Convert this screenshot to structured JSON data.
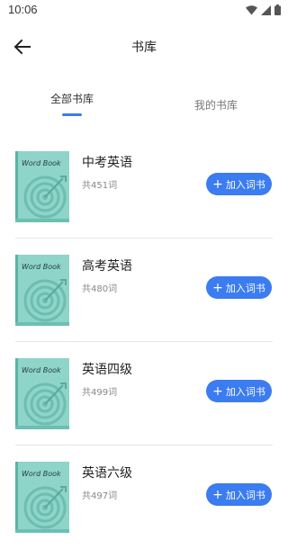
{
  "status_bar": {
    "time": "10:06"
  },
  "header": {
    "title": "书库"
  },
  "tabs": [
    {
      "label": "全部书库"
    },
    {
      "label": "我的书库"
    }
  ],
  "cover_text": "Word Book",
  "colors": {
    "accent": "#3b7cf0",
    "cover": "#8fd4c9"
  },
  "books": [
    {
      "name": "中考英语",
      "count": "共451词",
      "action": "加入词书"
    },
    {
      "name": "高考英语",
      "count": "共480词",
      "action": "加入词书"
    },
    {
      "name": "英语四级",
      "count": "共499词",
      "action": "加入词书"
    },
    {
      "name": "英语六级",
      "count": "共497词",
      "action": "加入词书"
    }
  ]
}
